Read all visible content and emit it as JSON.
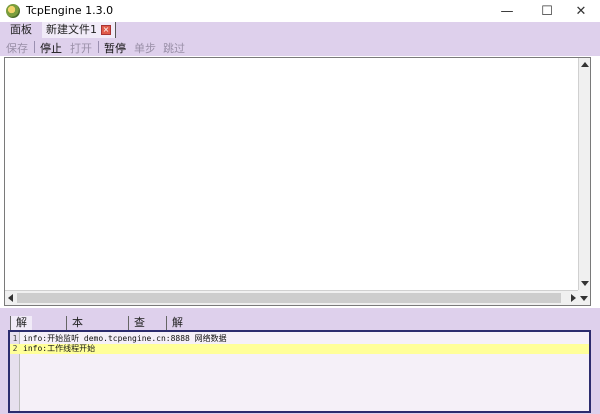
{
  "window": {
    "title": "TcpEngine 1.3.0",
    "minimize_glyph": "—",
    "maximize_glyph": "☐",
    "close_glyph": "✕"
  },
  "tabs": [
    {
      "label": "面板"
    },
    {
      "label": "新建文件1",
      "close_icon": "close-icon"
    }
  ],
  "toolbar": {
    "save": "保存",
    "stop": "停止",
    "open": "打开",
    "pause": "暂停",
    "step": "单步",
    "skip": "跳过"
  },
  "bottom_tabs": [
    {
      "label": "解析代码"
    },
    {
      "label": "本地日志"
    },
    {
      "label": "查找"
    },
    {
      "label": "解码库"
    }
  ],
  "log": {
    "lines": [
      {
        "num": "1",
        "text": "info:开始监听 demo.tcpengine.cn:8888 网络数据"
      },
      {
        "num": "2",
        "text": "info:工作线程开始"
      }
    ],
    "highlight_color": "#ffff99"
  },
  "colors": {
    "chrome": "#ded0ec",
    "active_tab": "#f1ebf8",
    "log_border": "#2c2c6e"
  }
}
